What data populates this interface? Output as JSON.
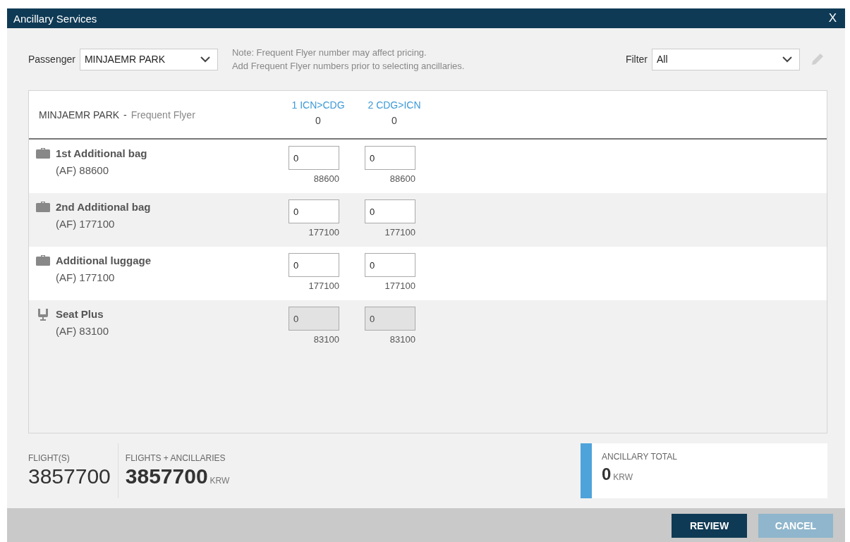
{
  "window": {
    "title": "Ancillary Services",
    "close": "X"
  },
  "passenger": {
    "label": "Passenger",
    "value": "MINJAEMR PARK"
  },
  "note": [
    "Note: Frequent Flyer number may affect pricing.",
    "Add Frequent Flyer numbers prior to selecting ancillaries."
  ],
  "filter": {
    "label": "Filter",
    "value": "All"
  },
  "table": {
    "passenger_name": "MINJAEMR PARK",
    "separator": "-",
    "status": "Frequent Flyer",
    "segments": [
      {
        "label": "1 ICN>CDG",
        "count": "0"
      },
      {
        "label": "2 CDG>ICN",
        "count": "0"
      }
    ],
    "rows": [
      {
        "kind": "bag",
        "name": "1st Additional bag",
        "price": "(AF) 88600",
        "cells": [
          {
            "value": "0",
            "price": "88600",
            "disabled": false
          },
          {
            "value": "0",
            "price": "88600",
            "disabled": false
          }
        ]
      },
      {
        "kind": "bag",
        "name": "2nd Additional bag",
        "price": "(AF) 177100",
        "cells": [
          {
            "value": "0",
            "price": "177100",
            "disabled": false
          },
          {
            "value": "0",
            "price": "177100",
            "disabled": false
          }
        ]
      },
      {
        "kind": "bag",
        "name": "Additional luggage",
        "price": "(AF) 177100",
        "cells": [
          {
            "value": "0",
            "price": "177100",
            "disabled": false
          },
          {
            "value": "0",
            "price": "177100",
            "disabled": false
          }
        ]
      },
      {
        "kind": "seat",
        "name": "Seat Plus",
        "price": "(AF) 83100",
        "cells": [
          {
            "value": "0",
            "price": "83100",
            "disabled": true
          },
          {
            "value": "0",
            "price": "83100",
            "disabled": true
          }
        ]
      }
    ]
  },
  "summary": {
    "flights_label": "FLIGHT(S)",
    "flights_value": "3857700",
    "total_label": "FLIGHTS + ANCILLARIES",
    "total_value": "3857700",
    "total_currency": "KRW",
    "ancillary_label": "ANCILLARY TOTAL",
    "ancillary_value": "0",
    "ancillary_currency": "KRW"
  },
  "buttons": [
    {
      "label": "REVIEW",
      "kind": "primary"
    },
    {
      "label": "CANCEL",
      "kind": "secondary"
    }
  ]
}
